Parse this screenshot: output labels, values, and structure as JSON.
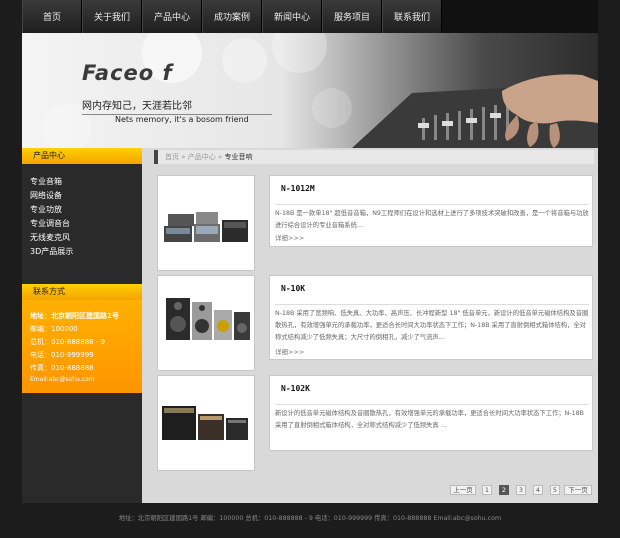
{
  "nav": [
    "首页",
    "关于我们",
    "产品中心",
    "成功案例",
    "新闻中心",
    "服务项目",
    "联系我们"
  ],
  "banner": {
    "logo": "Faceo f",
    "slogan": "网内存知己，天涯若比邻",
    "slogan_en": "Nets memory, it's a bosom friend"
  },
  "sidebar": {
    "products_title": "产品中心",
    "products": [
      "专业音箱",
      "网络设备",
      "专业功放",
      "专业调音台",
      "无线麦克风",
      "3D产品展示"
    ],
    "contact_title": "联系方式",
    "contact": [
      "地址：北京朝阳区建国路1号",
      "邮编：100000",
      "总机：010-888888 - 9",
      "电话：010-999999",
      "传真：010-888888",
      "Email:abc@sohu.com"
    ]
  },
  "breadcrumb": {
    "home": "首页",
    "sep": "»",
    "parent": "产品中心",
    "current": "专业音响"
  },
  "products": [
    {
      "title": "N-1012M",
      "desc": "N-18B 是一款单18\" 超低音音箱，N9工程师们在设计和选材上进行了多项技术突破和改善，是一个将音箱与功放进行综合设计的专业音箱系统…",
      "more": "详细>>>"
    },
    {
      "title": "N-10K",
      "desc": "N-18B 采用了宽频响、低失真、大功率、高声压、长冲程新型 18\" 低音单元，新设计的低音单元磁体结构及音圈散热孔，有效增强单元的承载功率，更适合长时间大功率状态下工作；N-18B 采用了直射倒相式箱体结构，全对称式结构减少了低频失真；大尺寸的倒相孔，减少了气流声…",
      "more": "详细>>>"
    },
    {
      "title": "N-102K",
      "desc": "新设计的低音单元磁体结构及音圈散热孔，有效增强单元的承载功率，更适合长时间大功率状态下工作；N-18B 采用了直射倒相式箱体结构，全对称式结构减少了低频失真 …",
      "more": ""
    }
  ],
  "pagination": {
    "prev": "上一页",
    "pages": [
      "1",
      "2",
      "3",
      "4",
      "5"
    ],
    "current": "2",
    "next": "下一页"
  },
  "footer": "地址：北京朝阳区建国路1号 邮编：100000 总机：010-888888 - 9 电话：010-999999 传真：010-888888 Email:abc@sohu.com",
  "colors": {
    "accent": "#ffb000",
    "dark": "#1c1c1c"
  }
}
